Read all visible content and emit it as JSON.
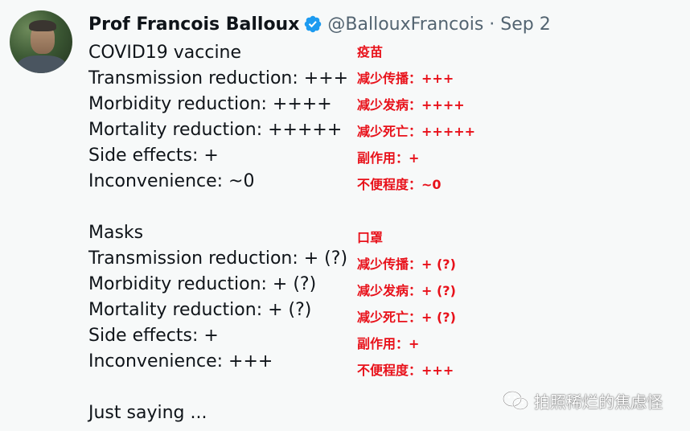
{
  "tweet": {
    "author_name": "Prof Francois Balloux",
    "handle_date": "@BallouxFrancois · Sep 2",
    "lines": [
      "COVID19 vaccine",
      "Transmission reduction: +++",
      "Morbidity reduction: ++++",
      "Mortality reduction: +++++",
      "Side effects: +",
      "Inconvenience: ~0",
      "Masks",
      "Transmission reduction: + (?)",
      "Morbidity reduction: + (?)",
      "Mortality reduction: + (?)",
      "Side effects: +",
      "Inconvenience: +++",
      "Just saying ..."
    ]
  },
  "annotations": [
    "疫苗",
    "减少传播：+++",
    "减少发病：++++",
    "减少死亡：+++++",
    "副作用：+",
    "不便程度：~0",
    "口罩",
    "减少传播：+ (?)",
    "减少发病：+ (?)",
    "减少死亡：+ (?)",
    "副作用：+",
    "不便程度：+++"
  ],
  "watermark": {
    "icon": "wechat-icon",
    "text": "拍照稀烂的焦虑怪"
  },
  "colors": {
    "background": "#f7f9f9",
    "text": "#0f1419",
    "secondary": "#536471",
    "verified": "#1d9bf0",
    "annotation": "#e8111a"
  }
}
